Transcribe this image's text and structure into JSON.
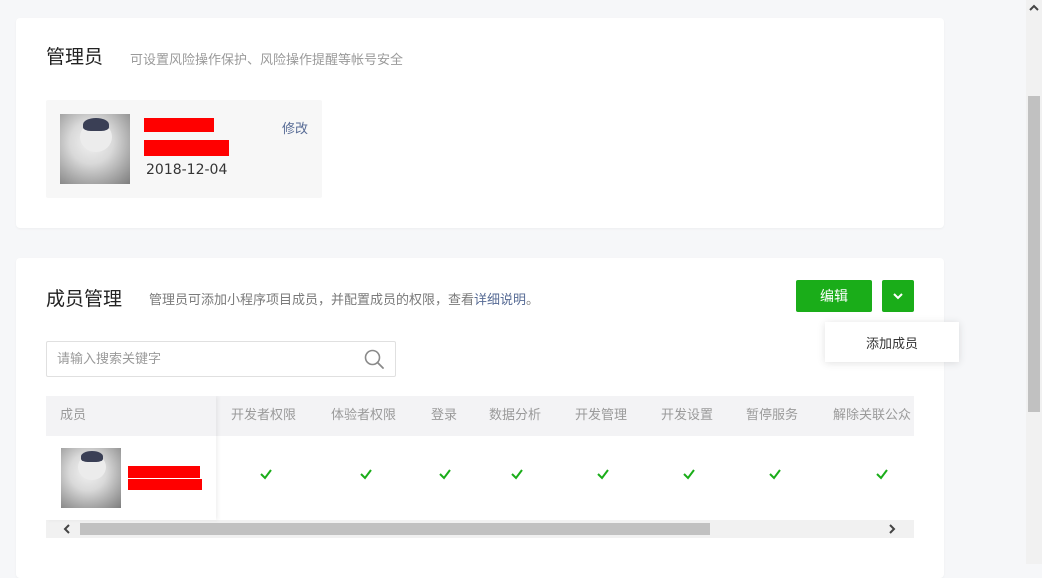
{
  "admin": {
    "title": "管理员",
    "desc": "可设置风险操作保护、风险操作提醒等帐号安全",
    "edit_label": "修改",
    "date": "2018-12-04"
  },
  "members": {
    "title": "成员管理",
    "desc_prefix": "管理员可添加小程序项目成员，并配置成员的权限，查看",
    "desc_link": "详细说明",
    "desc_suffix": "。",
    "edit_button": "编辑",
    "dropdown": {
      "items": [
        "添加成员"
      ]
    },
    "search": {
      "placeholder": "请输入搜索关键字",
      "value": ""
    },
    "table": {
      "member_header": "成员",
      "columns": [
        "开发者权限",
        "体验者权限",
        "登录",
        "数据分析",
        "开发管理",
        "开发设置",
        "暂停服务",
        "解除关联公众"
      ],
      "rows": [
        {
          "permissions": [
            true,
            true,
            true,
            true,
            true,
            true,
            true,
            true
          ]
        }
      ]
    }
  },
  "colors": {
    "accent": "#1aad19",
    "link": "#576b95",
    "check": "#1aad19",
    "redaction": "#ff0000"
  },
  "icons": [
    "search-icon",
    "chevron-down-icon",
    "check-icon",
    "chevron-left-icon",
    "chevron-right-icon",
    "chevron-up-icon"
  ]
}
